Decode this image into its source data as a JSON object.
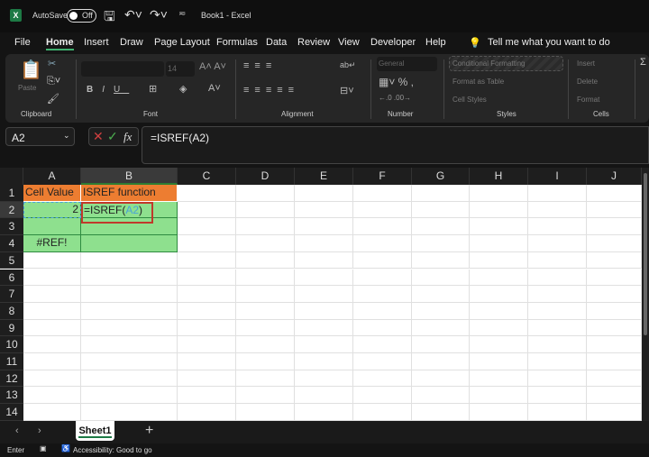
{
  "titlebar": {
    "autosave": "AutoSave",
    "toggle": "Off",
    "title": "Book1  -  Excel"
  },
  "menu": [
    "File",
    "Home",
    "Insert",
    "Draw",
    "Page Layout",
    "Formulas",
    "Data",
    "Review",
    "View",
    "Developer",
    "Help"
  ],
  "tell_me": "Tell me what you want to do",
  "ribbon": {
    "paste": "Paste",
    "clipboard": "Clipboard",
    "font_size": "14",
    "font": "Font",
    "alignment": "Alignment",
    "number_format": "General",
    "number": "Number",
    "conditional": "Conditional Formatting",
    "format_table": "Format as Table",
    "cell_styles": "Cell Styles",
    "styles": "Styles",
    "insert": "Insert",
    "delete": "Delete",
    "format": "Format",
    "cells": "Cells"
  },
  "formula_bar": {
    "name_box": "A2",
    "formula": "=ISREF(A2)"
  },
  "columns": [
    "A",
    "B",
    "C",
    "D",
    "E",
    "F",
    "G",
    "H",
    "I",
    "J"
  ],
  "rows": [
    "1",
    "2",
    "3",
    "4",
    "5",
    "6",
    "7",
    "8",
    "9",
    "10",
    "11",
    "12",
    "13",
    "14"
  ],
  "cells": {
    "a1": "Cell Value",
    "b1": "ISREF function",
    "a2": "2",
    "b2_prefix": "=ISREF(",
    "b2_ref": "A2",
    "b2_suffix": ")",
    "a4": "#REF!"
  },
  "colors": {
    "header_fill": "#ed7d31",
    "data_fill": "#8ee08e",
    "edit_border": "#c0392b",
    "ref_color": "#4aa3d8"
  },
  "sheet_tab": "Sheet1",
  "status": {
    "mode": "Enter",
    "accessibility": "Accessibility: Good to go"
  }
}
